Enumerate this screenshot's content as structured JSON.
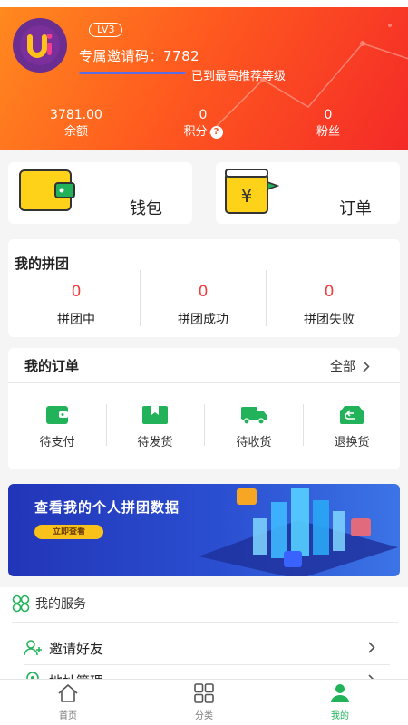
{
  "profile": {
    "level": "LV3",
    "invite_text": "专属邀请码：7782",
    "level_progress": 1.0,
    "level_status": "已到最高推荐等级"
  },
  "stats": [
    {
      "value": "3781.00",
      "label": "余额"
    },
    {
      "value": "0",
      "label": "积分"
    },
    {
      "value": "0",
      "label": "粉丝"
    }
  ],
  "tiles": {
    "wallet": "钱包",
    "orders": "订单"
  },
  "group": {
    "title": "我的拼团",
    "items": [
      {
        "value": "0",
        "label": "拼团中"
      },
      {
        "value": "0",
        "label": "拼团成功"
      },
      {
        "value": "0",
        "label": "拼团失败"
      }
    ]
  },
  "my_orders": {
    "title": "我的订单",
    "all": "全部",
    "items": [
      {
        "label": "待支付",
        "icon": "wallet-icon"
      },
      {
        "label": "待发货",
        "icon": "box-icon"
      },
      {
        "label": "待收货",
        "icon": "truck-icon"
      },
      {
        "label": "退换货",
        "icon": "return-icon"
      }
    ]
  },
  "banner": {
    "title": "查看我的个人拼团数据",
    "button": "立即查看"
  },
  "services": {
    "title": "我的服务",
    "items": [
      {
        "label": "邀请好友",
        "icon": "invite-user-icon"
      },
      {
        "label": "地址管理",
        "icon": "location-icon"
      }
    ]
  },
  "tabs": [
    {
      "label": "首页",
      "icon": "home-icon"
    },
    {
      "label": "分类",
      "icon": "grid-icon"
    },
    {
      "label": "我的",
      "icon": "user-icon"
    }
  ],
  "colors": {
    "accent_green": "#22b35a",
    "header_orange": "#ff7a1f",
    "header_red": "#f42a28",
    "number_red": "#f03c3c"
  }
}
